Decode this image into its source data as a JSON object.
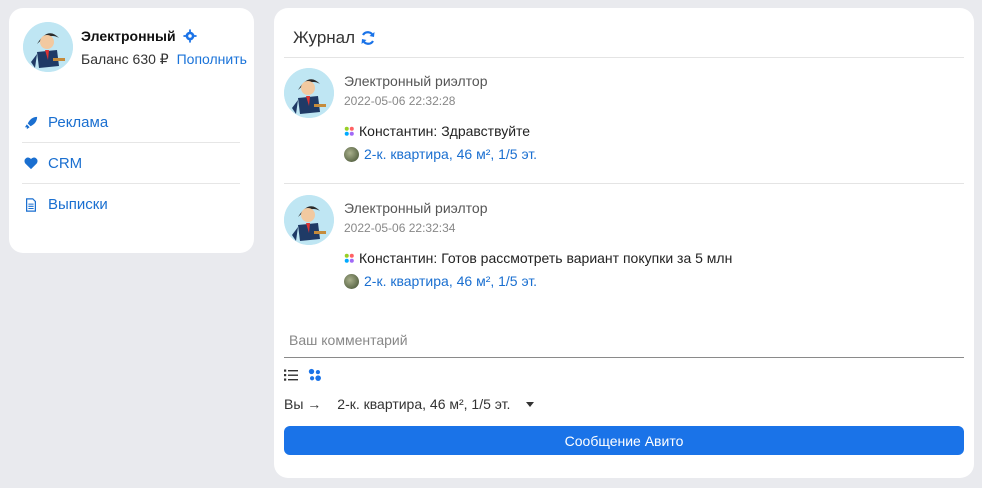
{
  "profile": {
    "name": "Электронный",
    "balance_label": "Баланс 630 ₽",
    "topup_label": "Пополнить"
  },
  "nav": {
    "items": [
      {
        "label": "Реклама",
        "icon": "rocket-icon"
      },
      {
        "label": "CRM",
        "icon": "heart-icon"
      },
      {
        "label": "Выписки",
        "icon": "document-icon"
      }
    ]
  },
  "journal": {
    "title": "Журнал",
    "entries": [
      {
        "author": "Электронный риэлтор",
        "time": "2022-05-06 22:32:28",
        "message": "Константин: Здравствуйте",
        "listing": "2-к. квартира, 46 м², 1/5 эт."
      },
      {
        "author": "Электронный риэлтор",
        "time": "2022-05-06 22:32:34",
        "message": "Константин: Готов рассмотреть вариант покупки за 5 млн",
        "listing": "2-к. квартира, 46 м², 1/5 эт."
      }
    ]
  },
  "composer": {
    "placeholder": "Ваш комментарий",
    "target_prefix": "Вы →",
    "target_value": "2-к. квартира, 46 м², 1/5 эт.",
    "send_label": "Сообщение Авито"
  },
  "colors": {
    "accent": "#1a73e8",
    "link": "#1a6fd0",
    "background": "#e9eaee"
  }
}
